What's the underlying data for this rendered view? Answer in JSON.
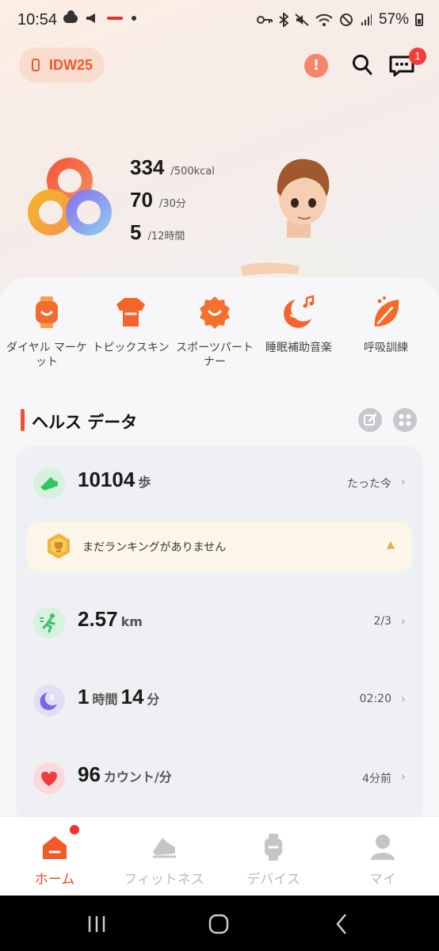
{
  "status_bar": {
    "time": "10:54",
    "battery": "57%"
  },
  "header": {
    "device_name": "IDW25",
    "alert_glyph": "!",
    "message_badge": "1"
  },
  "activity": {
    "calories": {
      "value": "334",
      "goal": "/500kcal"
    },
    "minutes": {
      "value": "70",
      "goal": "/30分"
    },
    "hours": {
      "value": "5",
      "goal": "/12時間"
    }
  },
  "shortcuts": [
    {
      "label": "ダイヤル マーケット",
      "icon": "watch-dial-icon"
    },
    {
      "label": "トピックスキン",
      "icon": "shirt-icon"
    },
    {
      "label": "スポーツパートナー",
      "icon": "smile-badge-icon"
    },
    {
      "label": "睡眠補助音楽",
      "icon": "moon-music-icon"
    },
    {
      "label": "呼吸訓練",
      "icon": "leaf-icon"
    }
  ],
  "health": {
    "section_title": "ヘルス データ",
    "steps": {
      "value": "10104",
      "unit": "歩",
      "time": "たった今"
    },
    "ranking_text": "まだランキングがありません",
    "distance": {
      "value": "2.57",
      "unit": "km",
      "time": "2/3"
    },
    "sleep": {
      "hours": "1",
      "hours_unit": "時間",
      "minutes": "14",
      "minutes_unit": "分",
      "time": "02:20"
    },
    "heart": {
      "value": "96",
      "unit": "カウント/分",
      "time": "4分前"
    }
  },
  "bottom_nav": {
    "home": "ホーム",
    "fitness": "フィットネス",
    "devices": "デバイス",
    "me": "マイ"
  },
  "colors": {
    "accent": "#ef4a22",
    "badge": "#f23c3c"
  }
}
